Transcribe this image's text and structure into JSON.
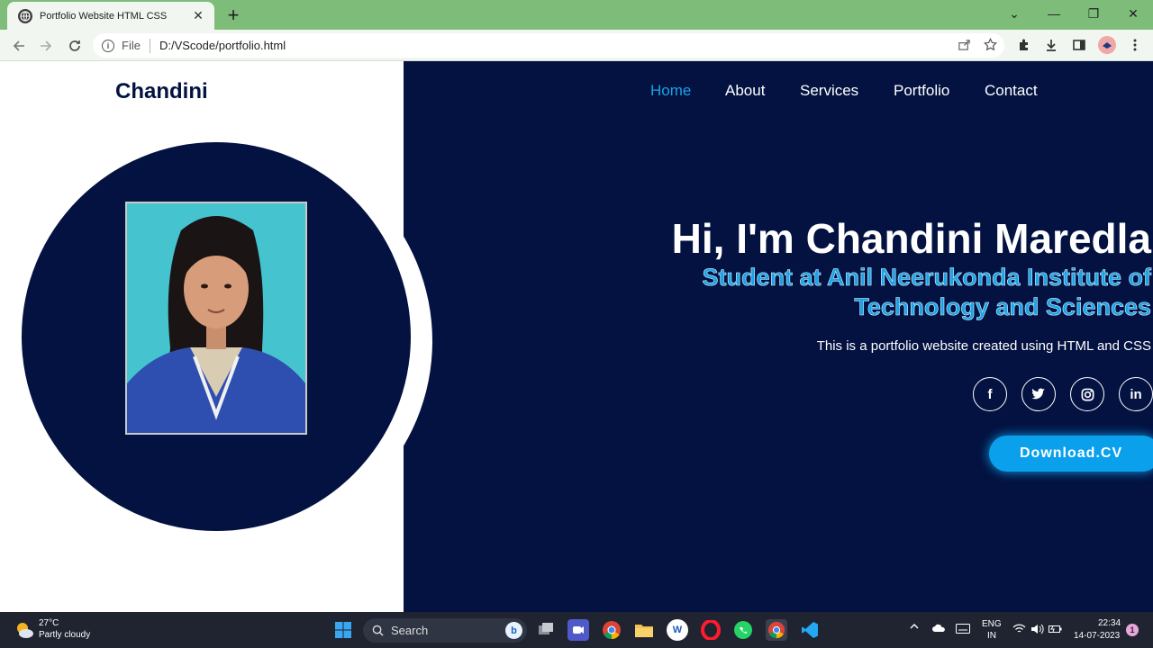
{
  "browser": {
    "tab_title": "Portfolio Website HTML CSS",
    "tab_close": "✕",
    "new_tab": "+",
    "address_scheme_label": "File",
    "address_url": "D:/VScode/portfolio.html",
    "window_controls": [
      "⌄",
      "—",
      "❐",
      "✕"
    ]
  },
  "site": {
    "logo": "Chandini",
    "nav": [
      "Home",
      "About",
      "Services",
      "Portfolio",
      "Contact"
    ],
    "active_nav": "Home",
    "hero_title": "Hi, I'm Chandini Maredla",
    "hero_subtitle": "Student at Anil Neerukonda Institute of Technology and Sciences",
    "hero_description": "This is a portfolio website created using HTML and CSS",
    "social": [
      "f",
      "twitter-icon",
      "instagram-icon",
      "in"
    ],
    "cv_button": "Download.CV",
    "accent_color": "#1aa3e8",
    "dark_bg_color": "#031240"
  },
  "taskbar": {
    "weather_temp": "27°C",
    "weather_text": "Partly cloudy",
    "search_placeholder": "Search",
    "lang_line1": "ENG",
    "lang_line2": "IN",
    "time": "22:34",
    "date": "14-07-2023",
    "notifications": "1"
  }
}
